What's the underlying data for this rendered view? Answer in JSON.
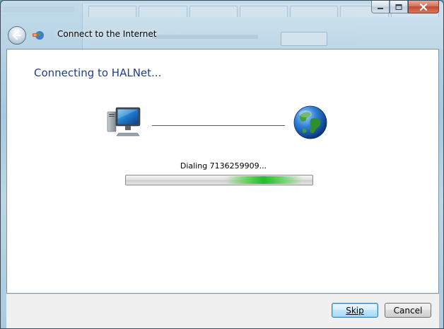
{
  "window": {
    "title": "Connect to the Internet",
    "caption_buttons": [
      "minimize-icon",
      "maximize-icon",
      "close-icon"
    ]
  },
  "wizard": {
    "heading": "Connecting to HALNet...",
    "left_icon": "computer-icon",
    "right_icon": "globe-icon",
    "status_text": "Dialing 7136259909...",
    "progress_mode": "indeterminate"
  },
  "buttons": {
    "skip_label": "Skip",
    "cancel_label": "Cancel"
  },
  "colors": {
    "heading": "#1e3f8a",
    "progress_glow": "#27ba2e",
    "close_button": "#c04a33"
  }
}
